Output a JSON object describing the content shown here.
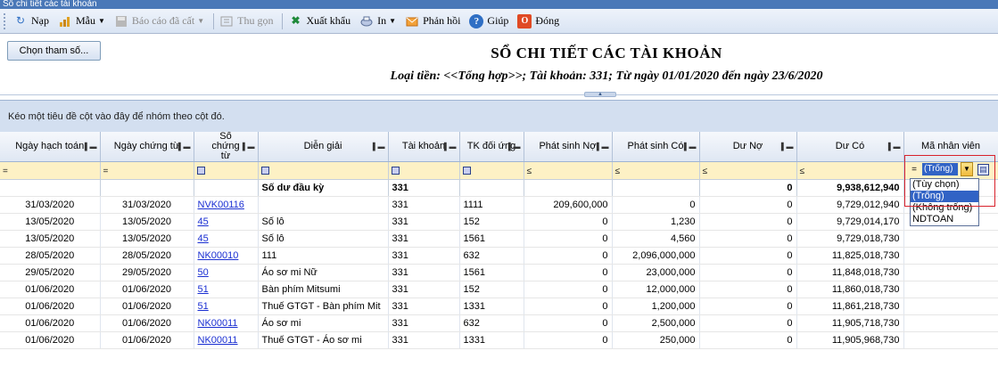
{
  "window": {
    "title": "Sổ chi tiết các tài khoản"
  },
  "toolbar": [
    {
      "label": "Nạp",
      "icon": "load-icon",
      "dropdown": false,
      "enabled": true
    },
    {
      "label": "Mẫu",
      "icon": "template-icon",
      "dropdown": true,
      "enabled": true
    },
    {
      "label": "Báo cáo đã cất",
      "icon": "saved-report-icon",
      "dropdown": true,
      "enabled": false
    },
    {
      "label": "Thu gọn",
      "icon": "collapse-icon",
      "dropdown": false,
      "enabled": false
    },
    {
      "label": "Xuất khẩu",
      "icon": "excel-icon",
      "dropdown": false,
      "enabled": true
    },
    {
      "label": "In",
      "icon": "print-icon",
      "dropdown": true,
      "enabled": true
    },
    {
      "label": "Phản hồi",
      "icon": "mail-icon",
      "dropdown": false,
      "enabled": true
    },
    {
      "label": "Giúp",
      "icon": "help-icon",
      "dropdown": false,
      "enabled": true
    },
    {
      "label": "Đóng",
      "icon": "close-icon",
      "dropdown": false,
      "enabled": true
    }
  ],
  "param_button": "Chọn tham số...",
  "report": {
    "title": "SỔ CHI TIẾT CÁC TÀI KHOẢN",
    "subtitle": "Loại tiền: <<Tổng hợp>>; Tài khoản: 331; Từ ngày 01/01/2020 đến ngày 23/6/2020"
  },
  "group_panel": "Kéo một tiêu đề cột vào đây để nhóm theo cột đó.",
  "columns": [
    "Ngày hạch toán",
    "Ngày chứng từ",
    "Số chứng từ",
    "Diễn giải",
    "Tài khoản",
    "TK đối ứng",
    "Phát sinh Nợ",
    "Phát sinh Có",
    "Dư Nợ",
    "Dư Có",
    "Mã nhân viên"
  ],
  "filter_ops": [
    "=",
    "=",
    "■",
    "■",
    "■",
    "■",
    "≤",
    "≤",
    "≤",
    "≤",
    "="
  ],
  "opening_row": {
    "description": "Số dư đầu kỳ",
    "account": "331",
    "debit_balance": "0",
    "credit_balance": "9,938,612,940"
  },
  "rows": [
    [
      "31/03/2020",
      "31/03/2020",
      "NVK00116",
      "",
      "331",
      "1111",
      "209,600,000",
      "0",
      "0",
      "9,729,012,940"
    ],
    [
      "13/05/2020",
      "13/05/2020",
      "45",
      "Số lô",
      "331",
      "152",
      "0",
      "1,230",
      "0",
      "9,729,014,170"
    ],
    [
      "13/05/2020",
      "13/05/2020",
      "45",
      "Số lô",
      "331",
      "1561",
      "0",
      "4,560",
      "0",
      "9,729,018,730"
    ],
    [
      "28/05/2020",
      "28/05/2020",
      "NK00010",
      " 111",
      "331",
      "632",
      "0",
      "2,096,000,000",
      "0",
      "11,825,018,730"
    ],
    [
      "29/05/2020",
      "29/05/2020",
      "50",
      "Áo sơ mi Nữ",
      "331",
      "1561",
      "0",
      "23,000,000",
      "0",
      "11,848,018,730"
    ],
    [
      "01/06/2020",
      "01/06/2020",
      "51",
      "Bàn phím Mitsumi",
      "331",
      "152",
      "0",
      "12,000,000",
      "0",
      "11,860,018,730"
    ],
    [
      "01/06/2020",
      "01/06/2020",
      "51",
      "Thuế GTGT - Bàn phím Mit",
      "331",
      "1331",
      "0",
      "1,200,000",
      "0",
      "11,861,218,730"
    ],
    [
      "01/06/2020",
      "01/06/2020",
      "NK00011",
      "Áo sơ mi",
      "331",
      "632",
      "0",
      "2,500,000",
      "0",
      "11,905,718,730"
    ],
    [
      "01/06/2020",
      "01/06/2020",
      "NK00011",
      "Thuế GTGT - Áo sơ mi",
      "331",
      "1331",
      "0",
      "250,000",
      "0",
      "11,905,968,730"
    ]
  ],
  "employee_filter": {
    "current": "(Trống)",
    "options": [
      "(Tùy chọn)",
      "(Trống)",
      "(Không trống)",
      "NDTOAN"
    ],
    "selected_index": 1
  }
}
